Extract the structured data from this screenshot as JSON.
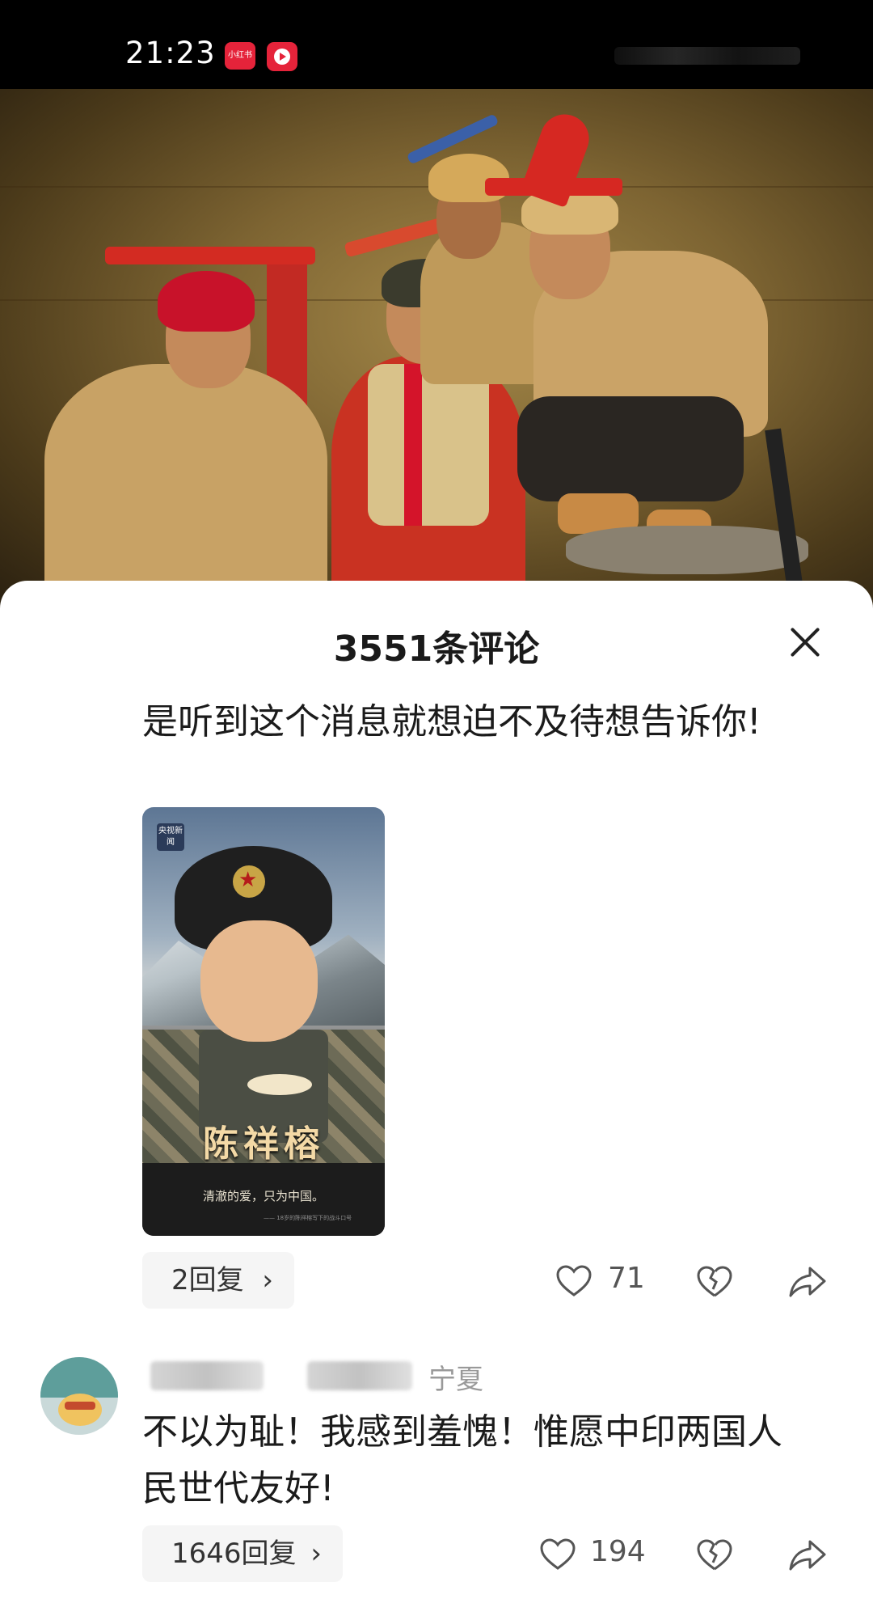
{
  "status_bar": {
    "time": "21:23",
    "app_badge_label": "小红书",
    "icons": [
      "xiaohongshu-app-icon",
      "video-app-icon"
    ]
  },
  "sheet": {
    "title": "3551条评论",
    "close_icon": "close-icon"
  },
  "comments": [
    {
      "text": "是听到这个消息就想迫不及待想告诉你!",
      "image": {
        "badge": "央视新闻",
        "name": "陈祥榕",
        "slogan": "清澈的爱，只为中国。",
        "fine_print": "—— 18岁的陈祥榕写下的战斗口号"
      },
      "replies_label": "2回复",
      "likes": "71"
    },
    {
      "location": "宁夏",
      "text": "不以为耻！我感到羞愧！惟愿中印两国人民世代友好!",
      "replies_label": "1646回复",
      "likes": "194"
    }
  ],
  "colors": {
    "accent_red": "#e5233a",
    "text_primary": "#1b1b1b",
    "text_secondary": "#999999"
  }
}
